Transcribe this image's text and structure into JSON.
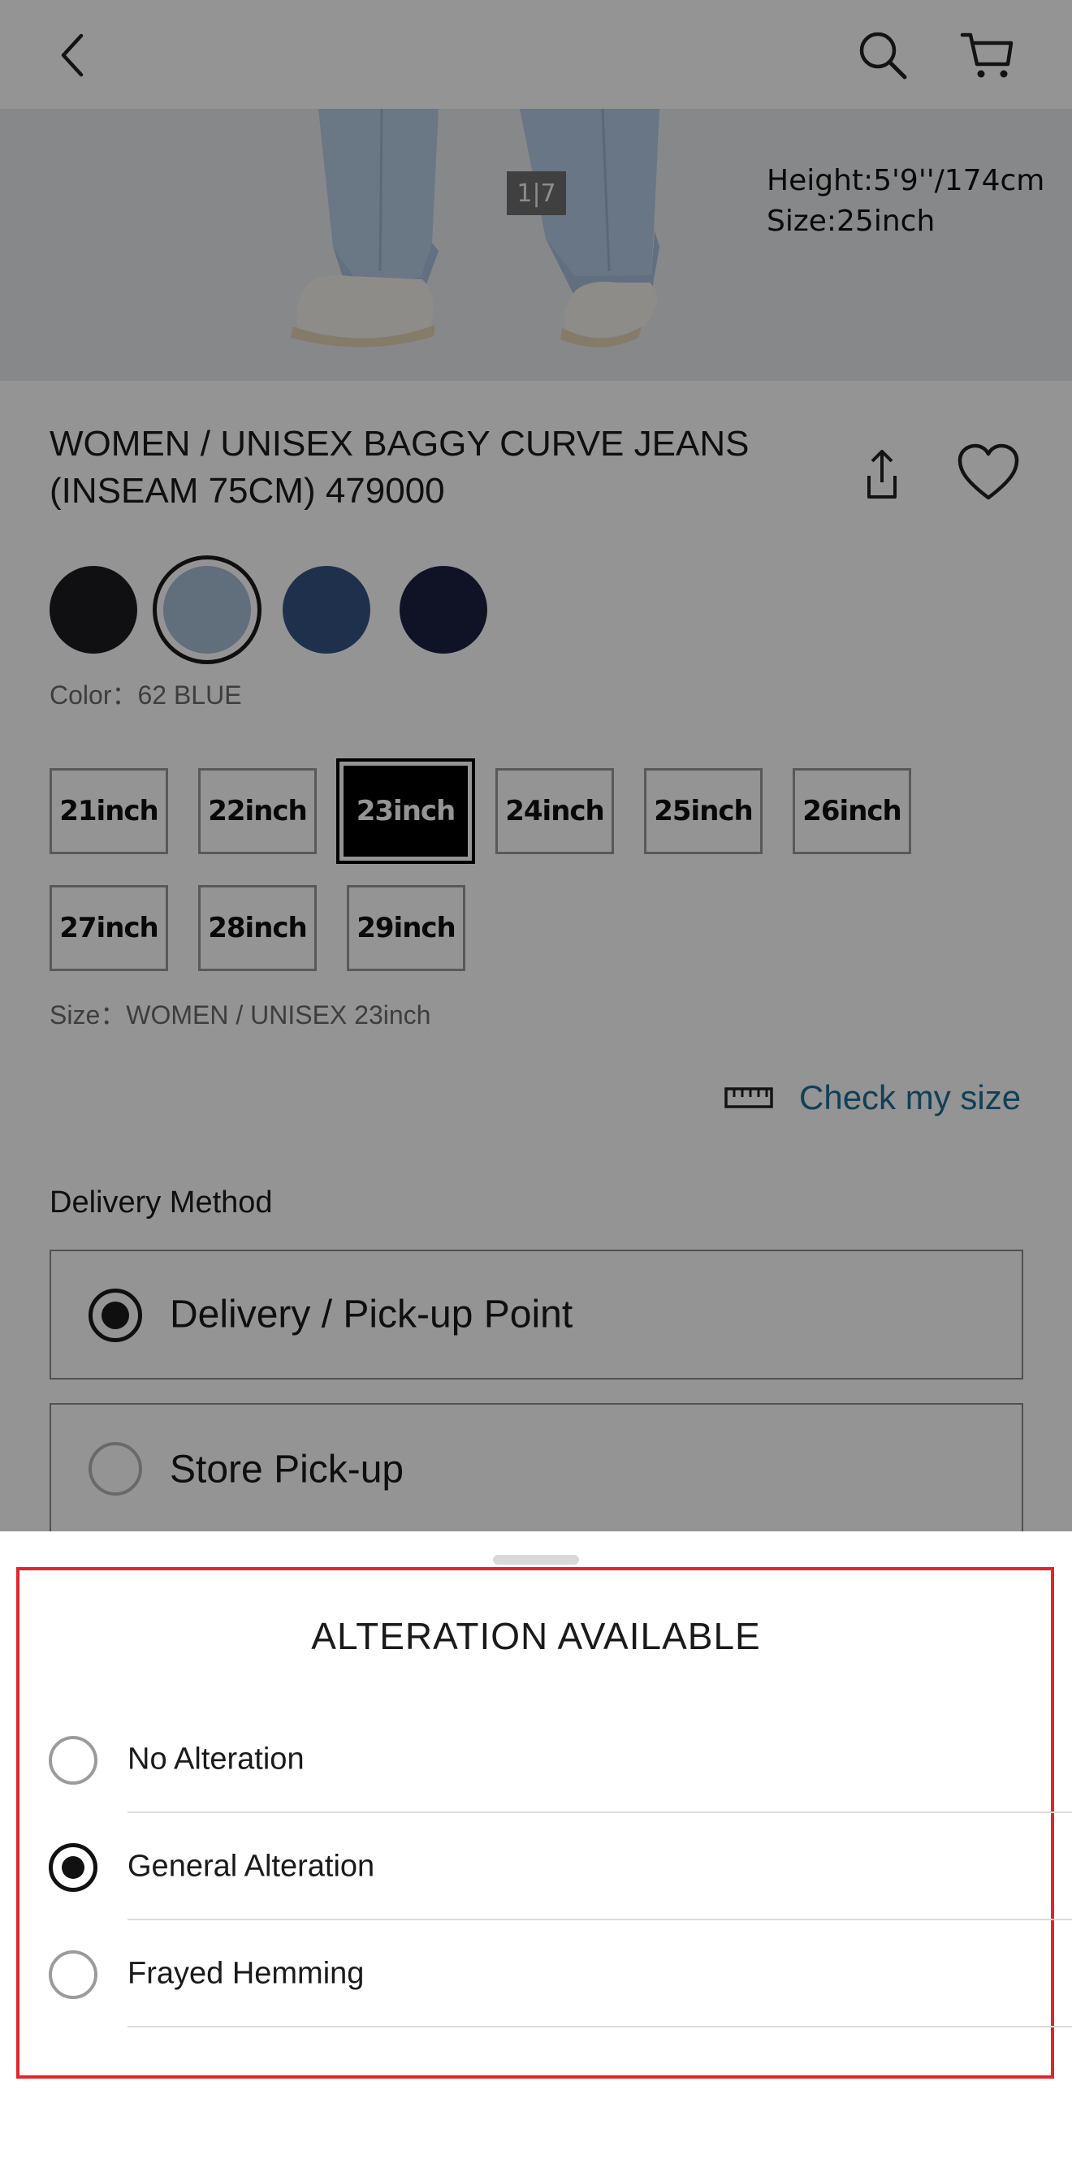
{
  "header": {
    "back_icon": "chevron-left-icon",
    "search_icon": "search-icon",
    "cart_icon": "cart-icon"
  },
  "gallery": {
    "counter": "1|7",
    "model_height": "Height:5'9''/174cm",
    "model_size": "Size:25inch"
  },
  "product": {
    "title": "WOMEN / UNISEX BAGGY CURVE JEANS (INSEAM 75CM) 479000",
    "share_icon": "share-icon",
    "favorite_icon": "heart-icon"
  },
  "colors": {
    "swatches": [
      {
        "hex": "#1c1d22",
        "selected": false
      },
      {
        "hex": "#a8bdd6",
        "selected": true
      },
      {
        "hex": "#365486",
        "selected": false
      },
      {
        "hex": "#1b2240",
        "selected": false
      }
    ],
    "label": "Color：62 BLUE"
  },
  "sizes": {
    "options": [
      "21inch",
      "22inch",
      "23inch",
      "24inch",
      "25inch",
      "26inch",
      "27inch",
      "28inch",
      "29inch"
    ],
    "selected": "23inch",
    "label": "Size：WOMEN / UNISEX 23inch"
  },
  "check_size": {
    "icon": "ruler-icon",
    "label": "Check my size"
  },
  "delivery": {
    "heading": "Delivery Method",
    "options": [
      {
        "label": "Delivery / Pick-up Point",
        "selected": true
      },
      {
        "label": "Store Pick-up",
        "selected": false
      }
    ]
  },
  "alteration_sheet": {
    "title": "ALTERATION AVAILABLE",
    "options": [
      {
        "label": "No Alteration",
        "selected": false
      },
      {
        "label": "General Alteration",
        "selected": true
      },
      {
        "label": "Frayed Hemming",
        "selected": false
      }
    ]
  },
  "colors_theme": {
    "link": "#1e6f95",
    "highlight_border": "#e0262b",
    "overlay": "rgba(0,0,0,0.42)"
  }
}
